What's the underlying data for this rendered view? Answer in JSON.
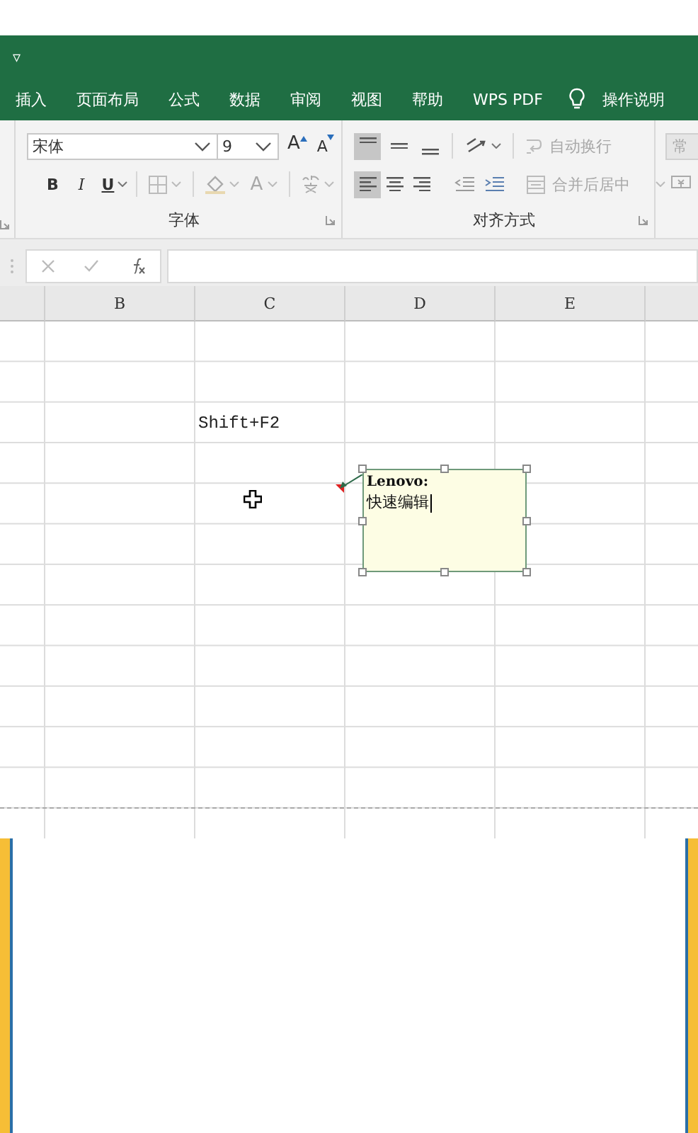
{
  "quick_access": {
    "customize_menu": "▿"
  },
  "ribbon_tabs": [
    {
      "kind": "tab",
      "label": "插入"
    },
    {
      "kind": "tab",
      "label": "页面布局"
    },
    {
      "kind": "tab",
      "label": "公式"
    },
    {
      "kind": "tab",
      "label": "数据"
    },
    {
      "kind": "tab",
      "label": "审阅"
    },
    {
      "kind": "tab",
      "label": "视图"
    },
    {
      "kind": "tab",
      "label": "帮助"
    },
    {
      "kind": "tab",
      "label": "WPS PDF"
    },
    {
      "kind": "search",
      "label": "操作说明"
    }
  ],
  "font_group": {
    "font_name": "宋体",
    "font_size": "9",
    "grow_font": "A",
    "shrink_font": "A",
    "bold": "B",
    "italic": "I",
    "underline": "U",
    "font_color": "A",
    "label": "字体"
  },
  "alignment_group": {
    "vertical_align": [
      {
        "kind": "top",
        "selected": true
      },
      {
        "kind": "middle",
        "selected": false
      },
      {
        "kind": "bottom",
        "selected": false
      }
    ],
    "horizontal_align": [
      {
        "kind": "left",
        "selected": true
      },
      {
        "kind": "center",
        "selected": false
      },
      {
        "kind": "right",
        "selected": false
      }
    ],
    "wrap_text": {
      "label": "自动换行",
      "disabled": true
    },
    "merge_center": {
      "label": "合并后居中",
      "disabled": true
    },
    "label": "对齐方式"
  },
  "number_group": {
    "format": "常"
  },
  "columns": [
    {
      "header": "B"
    },
    {
      "header": "C",
      "text": "Shift+F2"
    },
    {
      "header": "D"
    },
    {
      "header": "E"
    }
  ],
  "comment": {
    "author": "Lenovo:",
    "text": "快速编辑",
    "editing": true
  }
}
